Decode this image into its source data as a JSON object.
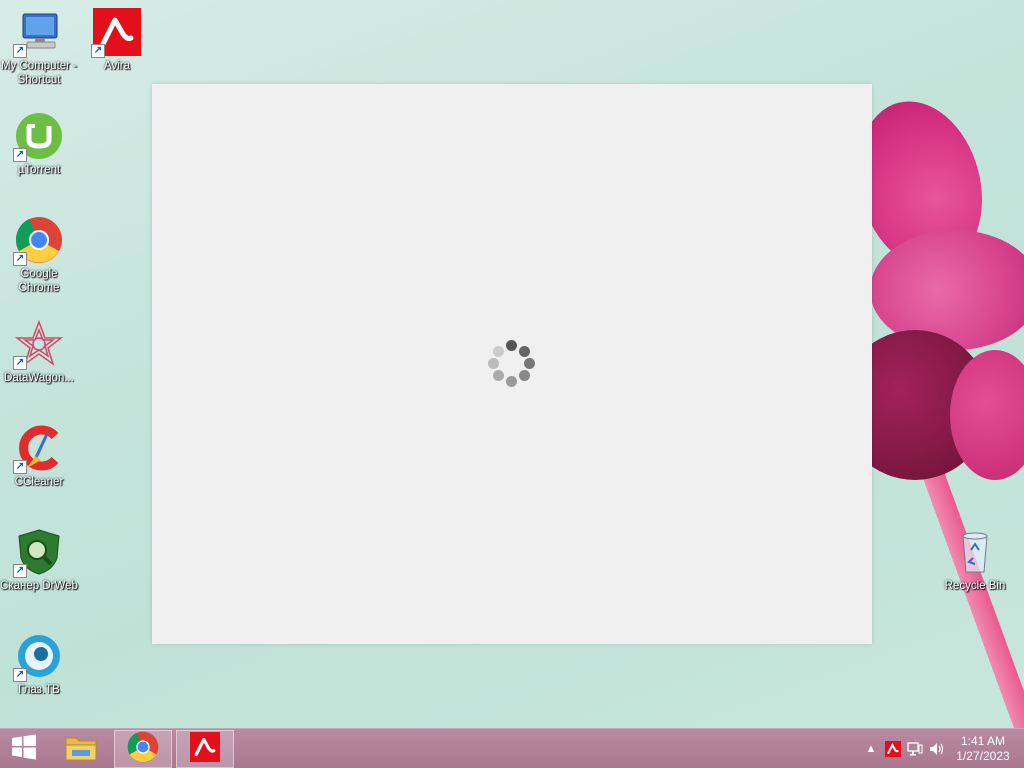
{
  "desktop": {
    "icons": [
      {
        "label": "My Computer - Shortcut",
        "icon": "computer-icon"
      },
      {
        "label": "Avira",
        "icon": "avira-icon"
      },
      {
        "label": "µTorrent",
        "icon": "utorrent-icon"
      },
      {
        "label": "Google Chrome",
        "icon": "chrome-icon"
      },
      {
        "label": "DataWagon...",
        "icon": "datawagon-icon"
      },
      {
        "label": "CCleaner",
        "icon": "ccleaner-icon"
      },
      {
        "label": "Сканер DrWeb",
        "icon": "drweb-icon"
      },
      {
        "label": "Глаз.ТВ",
        "icon": "glaz-tv-icon"
      },
      {
        "label": "Recycle Bin",
        "icon": "recycle-bin-icon"
      }
    ]
  },
  "loading_window": {
    "state": "loading",
    "spinner": "spinner-icon"
  },
  "taskbar": {
    "start": "windows-start-icon",
    "pinned": [
      {
        "name": "File Explorer",
        "icon": "file-explorer-icon",
        "active": false
      },
      {
        "name": "Google Chrome",
        "icon": "chrome-icon",
        "active": true
      },
      {
        "name": "Avira",
        "icon": "avira-icon",
        "active": true
      }
    ],
    "tray": {
      "icons": [
        "show-hidden-icons-icon",
        "avira-tray-icon",
        "network-icon",
        "volume-icon"
      ],
      "time": "1:41 AM",
      "date": "1/27/2023"
    }
  },
  "colors": {
    "taskbar": "#a9788f",
    "avira_red": "#e3101c",
    "window_bg": "#f0f0f0"
  }
}
